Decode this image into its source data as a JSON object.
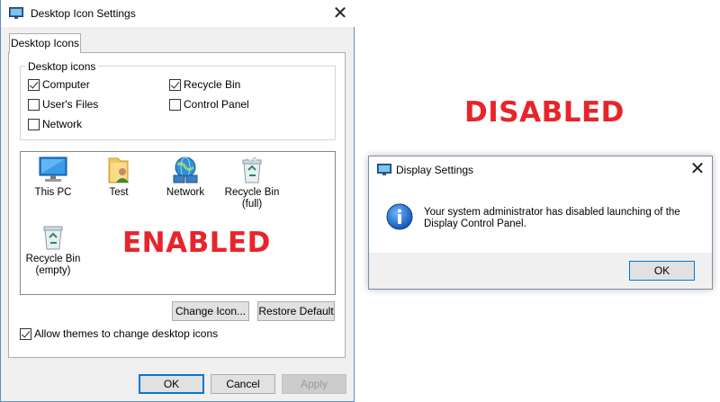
{
  "desktop_icon_settings": {
    "title": "Desktop Icon Settings",
    "tab_label": "Desktop Icons",
    "group_label": "Desktop icons",
    "checkboxes": [
      {
        "label": "Computer",
        "checked": true
      },
      {
        "label": "Recycle Bin",
        "checked": true
      },
      {
        "label": "User's Files",
        "checked": false
      },
      {
        "label": "Control Panel",
        "checked": false
      },
      {
        "label": "Network",
        "checked": false
      }
    ],
    "icons": [
      {
        "label": "This PC",
        "icon": "computer-icon"
      },
      {
        "label": "Test",
        "icon": "user-folder-icon"
      },
      {
        "label": "Network",
        "icon": "network-icon"
      },
      {
        "label": "Recycle Bin\n(full)",
        "icon": "recycle-bin-full-icon"
      },
      {
        "label": "Recycle Bin\n(empty)",
        "icon": "recycle-bin-empty-icon"
      }
    ],
    "status_overlay": "ENABLED",
    "change_icon_label": "Change Icon...",
    "restore_default_label": "Restore Default",
    "allow_themes_label": "Allow themes to change desktop icons",
    "allow_themes_checked": true,
    "ok_label": "OK",
    "cancel_label": "Cancel",
    "apply_label": "Apply"
  },
  "status_overlay_right": "DISABLED",
  "display_settings": {
    "title": "Display Settings",
    "message": "Your system administrator has disabled launching of the Display Control Panel.",
    "ok_label": "OK"
  },
  "colors": {
    "overlay_red": "#e8242b",
    "accent_blue": "#0078d7",
    "dialog_bg": "#f0f0f0"
  }
}
